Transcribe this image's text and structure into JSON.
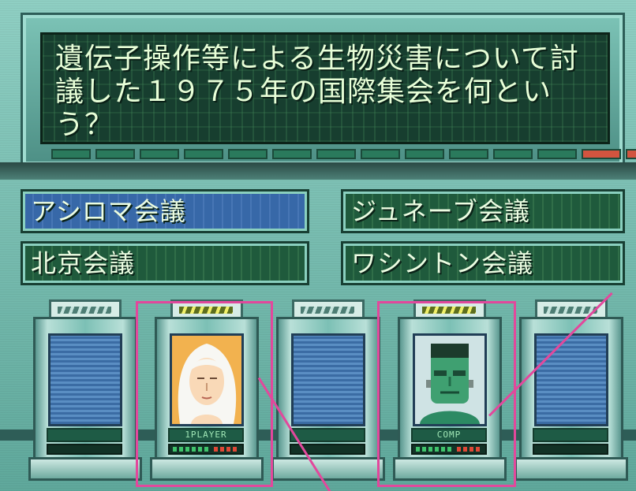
{
  "question": {
    "text": "遺伝子操作等による生物災害について討議した１９７５年の国際集会を何という？"
  },
  "answers": [
    {
      "label": "アシロマ会議",
      "selected": true
    },
    {
      "label": "ジュネーブ会議",
      "selected": false
    },
    {
      "label": "北京会議",
      "selected": false
    },
    {
      "label": "ワシントン会議",
      "selected": false
    }
  ],
  "booths": [
    {
      "nameplate": "",
      "occupant": "empty"
    },
    {
      "nameplate": "1PLAYER",
      "occupant": "player",
      "score_green": 6,
      "score_red": 4
    },
    {
      "nameplate": "",
      "occupant": "empty"
    },
    {
      "nameplate": "COMP",
      "occupant": "computer",
      "score_green": 6,
      "score_red": 4
    },
    {
      "nameplate": "",
      "occupant": "empty"
    }
  ],
  "colors": {
    "highlight": "#e2489c",
    "selected_answer": "#3768a8",
    "answer": "#1f5a3c",
    "question_text": "#e8ffd8"
  }
}
